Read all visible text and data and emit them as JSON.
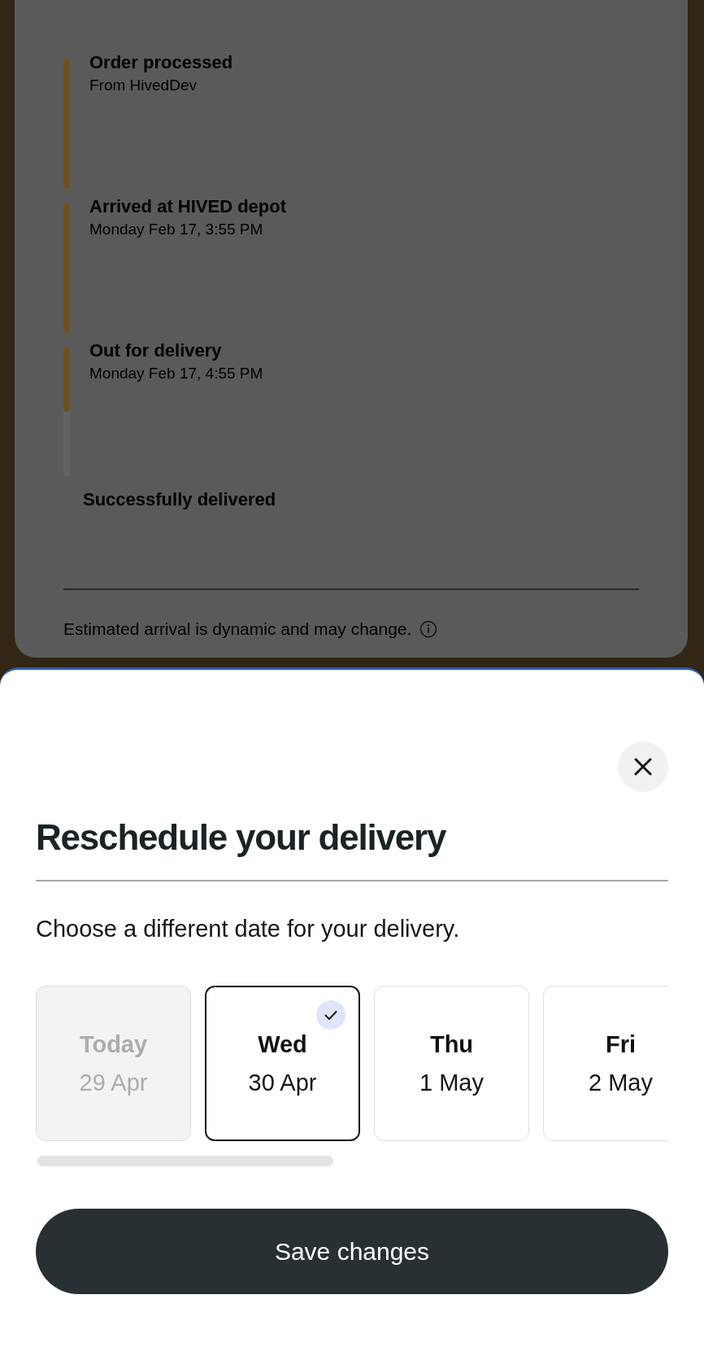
{
  "tracking": {
    "steps": [
      {
        "kind": "segment",
        "title": "Order processed",
        "detail": "From HivedDev",
        "level": 1
      },
      {
        "kind": "segment",
        "title": "Arrived at HIVED depot",
        "detail": "Monday Feb 17, 3:55 PM",
        "level": 1
      },
      {
        "kind": "segment",
        "title": "Out for delivery",
        "detail": "Monday Feb 17, 4:55 PM",
        "level": 0.5
      },
      {
        "kind": "final",
        "title": "Successfully delivered"
      }
    ],
    "note": "Estimated arrival is dynamic and may change."
  },
  "sheet": {
    "title": "Reschedule your delivery",
    "prompt": "Choose a different date for your delivery.",
    "dates": [
      {
        "day": "Today",
        "date": "29 Apr",
        "selected": false,
        "disabled": true
      },
      {
        "day": "Wed",
        "date": "30 Apr",
        "selected": true,
        "disabled": false
      },
      {
        "day": "Thu",
        "date": "1 May",
        "selected": false,
        "disabled": false
      },
      {
        "day": "Fri",
        "date": "2 May",
        "selected": false,
        "disabled": false
      }
    ],
    "save_label": "Save changes"
  }
}
